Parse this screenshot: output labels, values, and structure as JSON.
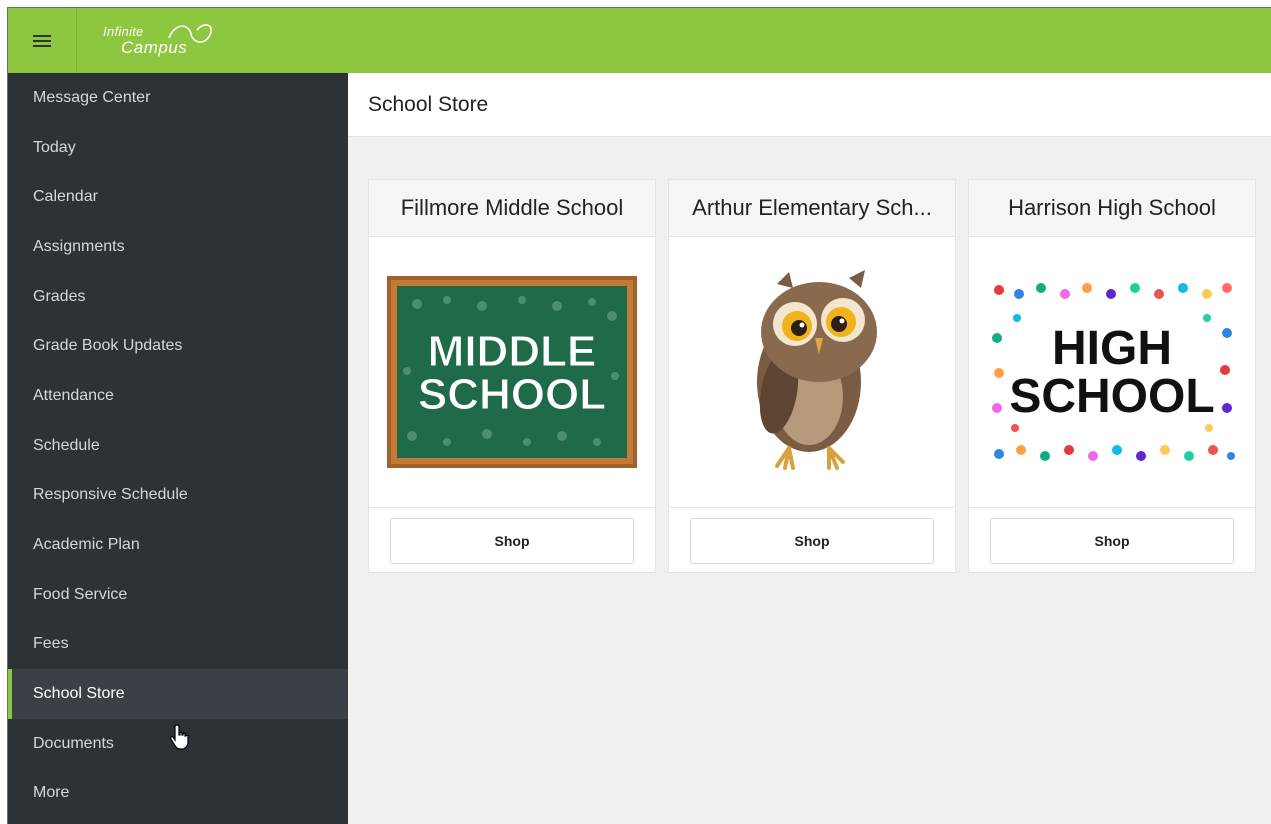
{
  "header": {
    "logo_line1": "Infinite",
    "logo_line2": "Campus",
    "brand_color": "#8dc63f"
  },
  "sidebar": {
    "items": [
      {
        "label": "Message Center"
      },
      {
        "label": "Today"
      },
      {
        "label": "Calendar"
      },
      {
        "label": "Assignments"
      },
      {
        "label": "Grades"
      },
      {
        "label": "Grade Book Updates"
      },
      {
        "label": "Attendance"
      },
      {
        "label": "Schedule"
      },
      {
        "label": "Responsive Schedule"
      },
      {
        "label": "Academic Plan"
      },
      {
        "label": "Food Service"
      },
      {
        "label": "Fees"
      },
      {
        "label": "School Store",
        "active": true
      },
      {
        "label": "Documents"
      },
      {
        "label": "More"
      }
    ]
  },
  "main": {
    "title": "School Store",
    "cards": [
      {
        "title": "Fillmore Middle School",
        "image_text_1": "MIDDLE",
        "image_text_2": "SCHOOL",
        "button": "Shop"
      },
      {
        "title": "Arthur Elementary Sch...",
        "image": "owl-illustration",
        "button": "Shop"
      },
      {
        "title": "Harrison High School",
        "image_text_1": "HIGH",
        "image_text_2": "SCHOOL",
        "button": "Shop"
      }
    ]
  }
}
